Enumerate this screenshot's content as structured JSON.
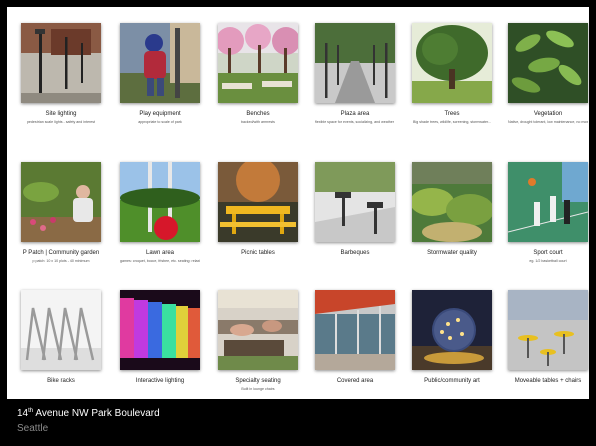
{
  "footer": {
    "title_pre": "14",
    "title_sup": "th",
    "title_post": " Avenue NW Park Boulevard",
    "subtitle": "Seattle"
  },
  "colors": {
    "background": "#000000",
    "slide": "#ffffff",
    "footer_title": "#ffffff",
    "footer_subtitle": "#8a8a8a"
  },
  "tiles": [
    {
      "title": "Site lighting",
      "sub": "pedestrian scale lights - safety and interest",
      "image": "street-lamps-photo"
    },
    {
      "title": "Play equipment",
      "sub": "appropriate to scale of park",
      "image": "child-play-photo"
    },
    {
      "title": "Benches",
      "sub": "backed/with armrests",
      "image": "park-benches-photo"
    },
    {
      "title": "Plaza area",
      "sub": "flexible space for events, socializing, and weather ext. block parties, craft fairs",
      "image": "tree-lined-plaza-photo"
    },
    {
      "title": "Trees",
      "sub": "Big shade trees, wildlife, screening, stormwater...",
      "image": "shade-tree-photo"
    },
    {
      "title": "Vegetation",
      "sub": "Native, drought tolerant, low maintenance, no mow lawns...",
      "image": "fern-foliage-photo"
    },
    {
      "title": "P Patch | Community garden",
      "sub": "p patch: 10 x 10 plots - 40 minimum",
      "image": "community-garden-photo"
    },
    {
      "title": "Lawn area",
      "sub": "games: croquet, bocce, frisbee, etc. seating: relaxing, reading, etc. performance: small or large",
      "image": "lawn-ball-photo"
    },
    {
      "title": "Picnic tables",
      "sub": "",
      "image": "picnic-table-photo"
    },
    {
      "title": "Barbeques",
      "sub": "",
      "image": "barbeque-grills-photo"
    },
    {
      "title": "Stormwater quality",
      "sub": "",
      "image": "rain-garden-photo"
    },
    {
      "title": "Sport court",
      "sub": "eg. 1/2 basketball court",
      "image": "basketball-court-photo"
    },
    {
      "title": "Bike racks",
      "sub": "",
      "image": "bike-rack-photo"
    },
    {
      "title": "Interactive lighting",
      "sub": "",
      "image": "colored-light-wall-photo"
    },
    {
      "title": "Specialty seating",
      "sub": "Built in lounge chairs",
      "image": "lounge-chairs-photo"
    },
    {
      "title": "Covered area",
      "sub": "",
      "image": "covered-walkway-photo"
    },
    {
      "title": "Public/community art",
      "sub": "",
      "image": "glowing-sphere-art-photo"
    },
    {
      "title": "Moveable tables + chairs",
      "sub": "",
      "image": "bistro-tables-photo"
    }
  ]
}
